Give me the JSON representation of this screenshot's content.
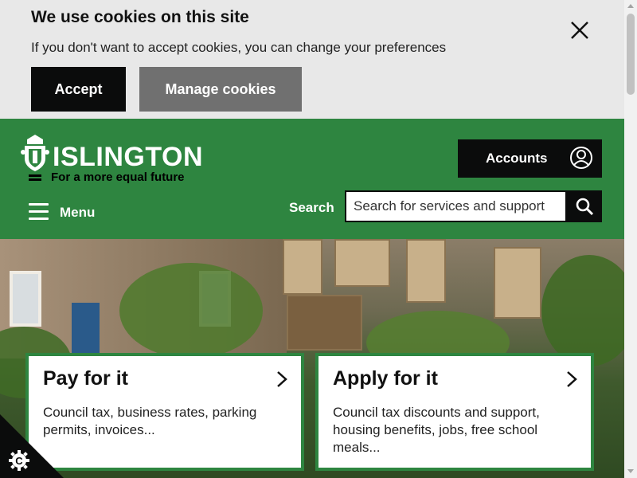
{
  "cookie_banner": {
    "title": "We use cookies on this site",
    "text": "If you don't want to accept cookies, you can change your preferences",
    "accept_label": "Accept",
    "manage_label": "Manage cookies",
    "close_icon": "close-icon"
  },
  "header": {
    "brand": "ISLINGTON",
    "tagline": "For a more equal future",
    "accounts_label": "Accounts",
    "menu_label": "Menu",
    "search_label": "Search",
    "search_placeholder": "Search for services and support",
    "colors": {
      "brand_green": "#2e8540",
      "dark": "#0b0c0c"
    }
  },
  "cards": [
    {
      "title": "Pay for it",
      "description": "Council tax, business rates, parking permits, invoices..."
    },
    {
      "title": "Apply for it",
      "description": "Council tax discounts and support, housing benefits, jobs, free school meals..."
    }
  ],
  "cookie_badge": {
    "letter": "C",
    "icon": "gear-icon"
  }
}
